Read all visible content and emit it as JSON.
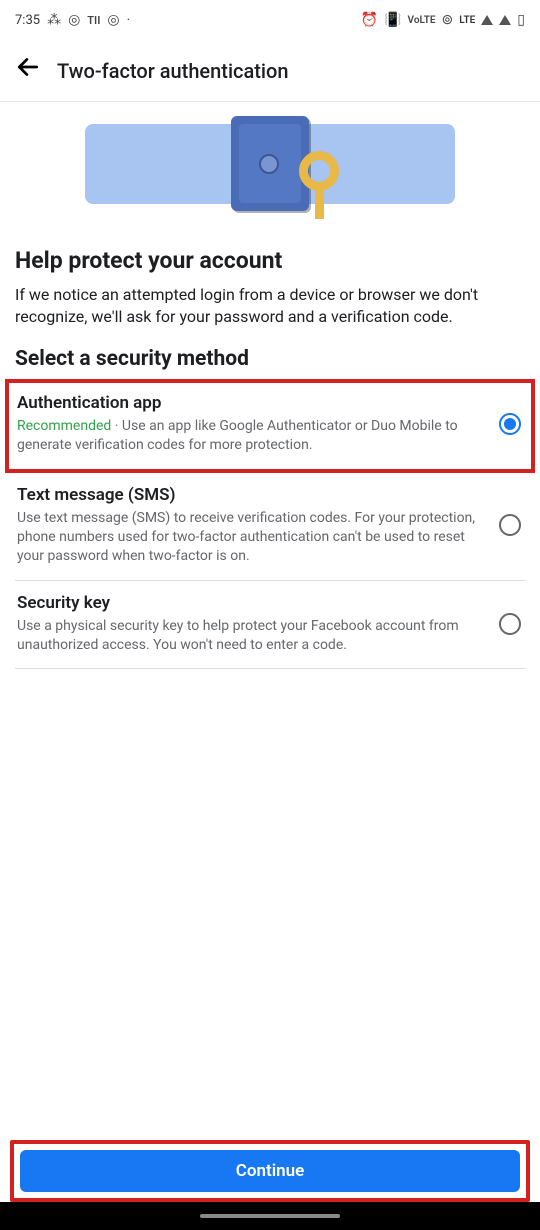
{
  "status_bar": {
    "time": "7:35",
    "network_label": "LTE"
  },
  "header": {
    "title": "Two-factor authentication"
  },
  "intro": {
    "heading": "Help protect your account",
    "body": "If we notice an attempted login from a device or browser we don't recognize, we'll ask for your password and a verification code."
  },
  "section_heading": "Select a security method",
  "options": [
    {
      "title": "Authentication app",
      "recommended_label": "Recommended",
      "desc": " · Use an app like Google Authenticator or Duo Mobile to generate verification codes for more protection.",
      "selected": true,
      "highlighted": true
    },
    {
      "title": "Text message (SMS)",
      "desc": "Use text message (SMS) to receive verification codes. For your protection, phone numbers used for two-factor authentication can't be used to reset your password when two-factor is on.",
      "selected": false,
      "highlighted": false
    },
    {
      "title": "Security key",
      "desc": "Use a physical security key to help protect your Facebook account from unauthorized access. You won't need to enter a code.",
      "selected": false,
      "highlighted": false
    }
  ],
  "footer": {
    "continue_label": "Continue"
  }
}
